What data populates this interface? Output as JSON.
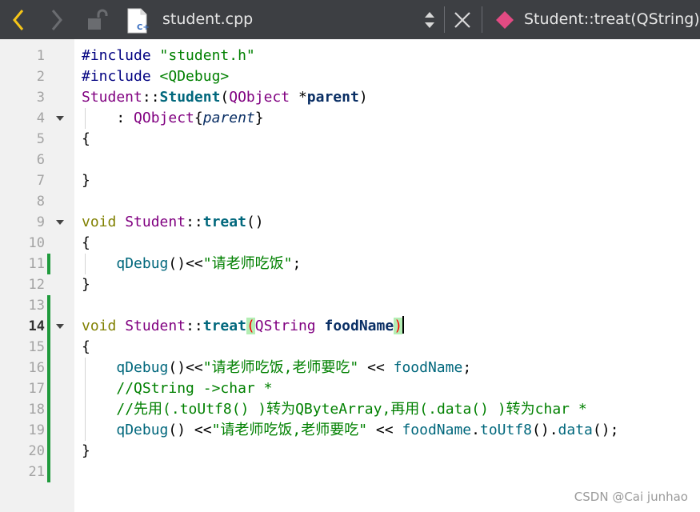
{
  "toolbar": {
    "file_name": "student.cpp",
    "function_name": "Student::treat(QString) ->",
    "icons": [
      "back-arrow-icon",
      "forward-arrow-icon",
      "lock-icon",
      "cpp-file-icon",
      "up-down-arrows-icon",
      "close-icon",
      "function-icon"
    ]
  },
  "editor": {
    "line_numbers": [
      "1",
      "2",
      "3",
      "4",
      "5",
      "6",
      "7",
      "8",
      "9",
      "10",
      "11",
      "12",
      "13",
      "14",
      "15",
      "16",
      "17",
      "18",
      "19",
      "20",
      "21"
    ],
    "current_line": "14",
    "lines": [
      [
        {
          "t": "#include ",
          "c": "pre"
        },
        {
          "t": "\"student.h\"",
          "c": "str"
        }
      ],
      [
        {
          "t": "#include ",
          "c": "pre"
        },
        {
          "t": "<QDebug>",
          "c": "str"
        }
      ],
      [
        {
          "t": "Student",
          "c": "type"
        },
        {
          "t": "::",
          "c": ""
        },
        {
          "t": "Student",
          "c": "fnb"
        },
        {
          "t": "(",
          "c": ""
        },
        {
          "t": "QObject",
          "c": "type"
        },
        {
          "t": " *",
          "c": ""
        },
        {
          "t": "parent",
          "c": "par"
        },
        {
          "t": ")",
          "c": ""
        }
      ],
      [
        {
          "t": "    : ",
          "c": ""
        },
        {
          "t": "QObject",
          "c": "type"
        },
        {
          "t": "{",
          "c": ""
        },
        {
          "t": "parent",
          "c": "it"
        },
        {
          "t": "}",
          "c": ""
        }
      ],
      [
        {
          "t": "{",
          "c": ""
        }
      ],
      [],
      [
        {
          "t": "}",
          "c": ""
        }
      ],
      [],
      [
        {
          "t": "void",
          "c": "kw"
        },
        {
          "t": " ",
          "c": ""
        },
        {
          "t": "Student",
          "c": "type"
        },
        {
          "t": "::",
          "c": ""
        },
        {
          "t": "treat",
          "c": "fnb"
        },
        {
          "t": "()",
          "c": ""
        }
      ],
      [
        {
          "t": "{",
          "c": ""
        }
      ],
      [
        {
          "t": "    ",
          "c": ""
        },
        {
          "t": "qDebug",
          "c": "fn"
        },
        {
          "t": "()<<",
          "c": ""
        },
        {
          "t": "\"请老师吃饭\"",
          "c": "str"
        },
        {
          "t": ";",
          "c": ""
        }
      ],
      [
        {
          "t": "}",
          "c": ""
        }
      ],
      [],
      [
        {
          "t": "void",
          "c": "kw"
        },
        {
          "t": " ",
          "c": ""
        },
        {
          "t": "Student",
          "c": "type"
        },
        {
          "t": "::",
          "c": ""
        },
        {
          "t": "treat",
          "c": "fnb"
        },
        {
          "t": "(",
          "c": "paren-hl"
        },
        {
          "t": "QString",
          "c": "type"
        },
        {
          "t": " ",
          "c": ""
        },
        {
          "t": "foodName",
          "c": "par"
        },
        {
          "t": ")",
          "c": "paren-hl"
        }
      ],
      [
        {
          "t": "{",
          "c": ""
        }
      ],
      [
        {
          "t": "    ",
          "c": ""
        },
        {
          "t": "qDebug",
          "c": "fn"
        },
        {
          "t": "()<<",
          "c": ""
        },
        {
          "t": "\"请老师吃饭,老师要吃\"",
          "c": "str"
        },
        {
          "t": " << ",
          "c": ""
        },
        {
          "t": "foodName",
          "c": "fn"
        },
        {
          "t": ";",
          "c": ""
        }
      ],
      [
        {
          "t": "    ",
          "c": ""
        },
        {
          "t": "//QString ->char *",
          "c": "com"
        }
      ],
      [
        {
          "t": "    ",
          "c": ""
        },
        {
          "t": "//先用(.toUtf8() )转为QByteArray,再用(.data() )转为char *",
          "c": "com"
        }
      ],
      [
        {
          "t": "    ",
          "c": ""
        },
        {
          "t": "qDebug",
          "c": "fn"
        },
        {
          "t": "() <<",
          "c": ""
        },
        {
          "t": "\"请老师吃饭,老师要吃\"",
          "c": "str"
        },
        {
          "t": " << ",
          "c": ""
        },
        {
          "t": "foodName",
          "c": "fn"
        },
        {
          "t": ".",
          "c": ""
        },
        {
          "t": "toUtf8",
          "c": "fn"
        },
        {
          "t": "().",
          "c": ""
        },
        {
          "t": "data",
          "c": "fn"
        },
        {
          "t": "();",
          "c": ""
        }
      ],
      [
        {
          "t": "}",
          "c": ""
        }
      ],
      []
    ]
  },
  "watermark": "CSDN @Cai junhao"
}
